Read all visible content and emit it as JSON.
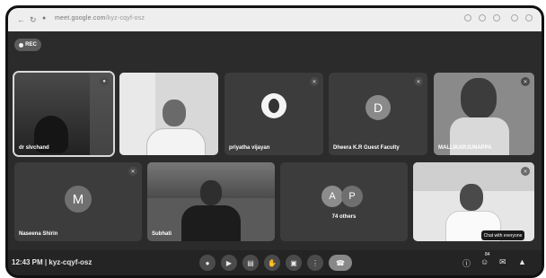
{
  "browser": {
    "url_host": "meet.google.com",
    "url_path": "/kyz-cqyf-osz",
    "back_icon": "arrow-left-icon",
    "reload_icon": "reload-icon"
  },
  "recording": {
    "label": "REC"
  },
  "participants": [
    {
      "name": "dr sIvchand",
      "type": "video",
      "pinned": true
    },
    {
      "name": "",
      "type": "video"
    },
    {
      "name": "priyatha vijayan",
      "type": "avatar-photo"
    },
    {
      "name": "Dheera K.R Guest Faculty",
      "type": "avatar",
      "initial": "D",
      "color": "#8a8a8a"
    },
    {
      "name": "MALLIKARJUNAPPA",
      "type": "video"
    },
    {
      "name": "Naseena Shirin",
      "type": "avatar",
      "initial": "M",
      "color": "#707070"
    },
    {
      "name": "Subhati",
      "type": "video"
    },
    {
      "name": "74 others",
      "type": "group",
      "initials": [
        "A",
        "P"
      ]
    },
    {
      "name": "",
      "type": "video"
    }
  ],
  "meeting": {
    "time_code": "12:43 PM  |  kyz-cqyf-osz"
  },
  "controls": {
    "mic_icon": "microphone-icon",
    "camera_icon": "camera-icon",
    "captions_icon": "captions-icon",
    "raise_hand_icon": "raise-hand-icon",
    "present_icon": "present-screen-icon",
    "more_icon": "more-options-icon",
    "end_call_icon": "end-call-icon"
  },
  "tooltip": {
    "text": "Chat with everyone"
  },
  "right_controls": {
    "info_icon": "info-icon",
    "people_icon": "people-icon",
    "people_count": "84",
    "chat_icon": "chat-icon",
    "activities_icon": "activities-icon"
  }
}
